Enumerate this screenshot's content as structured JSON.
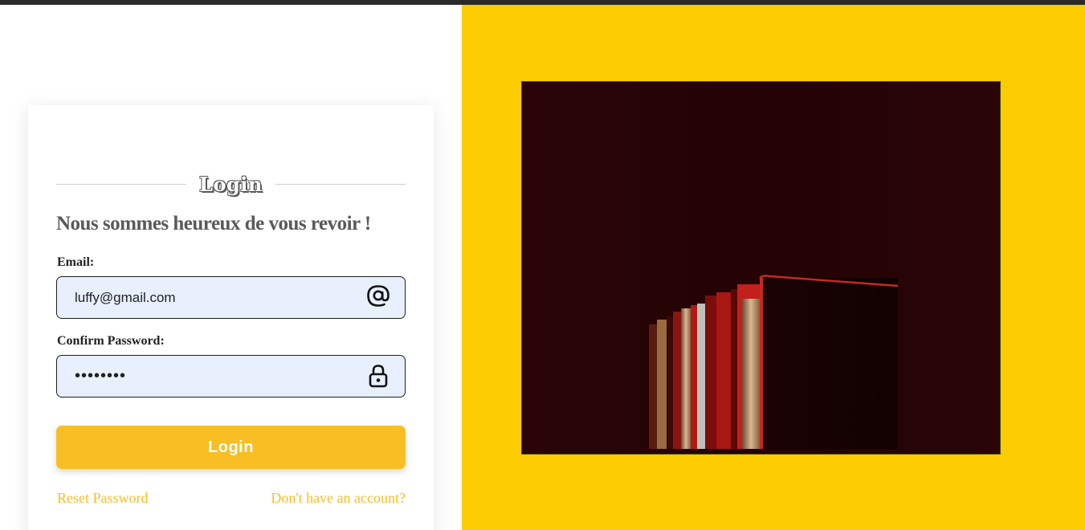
{
  "login_card": {
    "heading": "Login",
    "subtitle": "Nous sommes heureux de vous revoir !",
    "email": {
      "label": "Email:",
      "value": "luffy@gmail.com",
      "icon": "at-icon"
    },
    "password": {
      "label": "Confirm Password:",
      "value": "••••••••",
      "icon": "lock-icon"
    },
    "submit_label": "Login",
    "links": {
      "reset": "Reset Password",
      "signup": "Don't have an account?"
    }
  },
  "colors": {
    "accent": "#f8be24",
    "right_panel": "#fccc00",
    "input_bg": "#e8f0fe",
    "hero_bg": "#2a0406"
  },
  "hero_image": {
    "subject": "books-photo"
  }
}
